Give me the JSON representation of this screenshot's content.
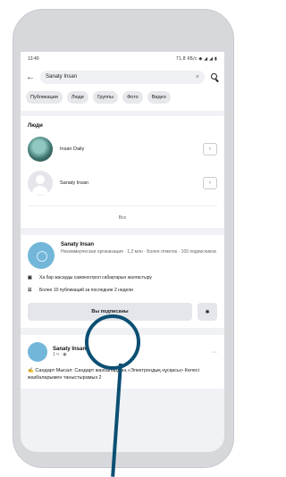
{
  "status_bar": {
    "time": "13:40",
    "icons": "71,8 КБ/с ◆ ◢ ◢ ▮"
  },
  "search": {
    "value": "Sanaty Insan",
    "clear_icon": "close-icon",
    "search_icon": "search-icon",
    "back_icon": "arrow-left-icon"
  },
  "tabs": [
    "Публикации",
    "Люди",
    "Группы",
    "Фото",
    "Видео"
  ],
  "people": {
    "title": "Люди",
    "items": [
      {
        "name": "Insan Daily"
      },
      {
        "name": "Sanaty Insan"
      }
    ],
    "see_all": "Все"
  },
  "page": {
    "name": "Sanaty Insan",
    "meta": "Некоммерческая организация · 1,2 млн · Более отметок · 100 подписчиков",
    "info1": "Ха бар жасауды самоконтрол сабақтарын жалғастыру",
    "info2": "Более 10 публикаций за последние 2 недели",
    "subscribe": "Вы подписаны",
    "more_icon": "more-icon"
  },
  "post": {
    "author": "Sanaty Insan",
    "time": "1 ч · ◉",
    "text": "✍️ Сандарт Мысал: Сандарт жазбалардың «Электрондық нұсқасы» Келесі жазбаларымен таныстырамыз 2"
  },
  "annotation": {
    "color": "#0b4f73"
  }
}
